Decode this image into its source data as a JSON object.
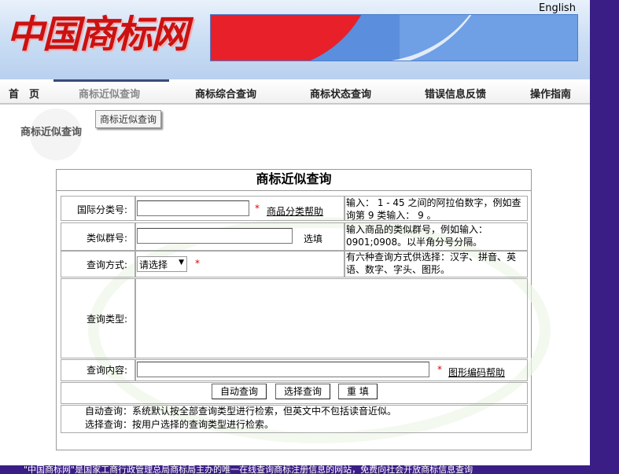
{
  "header": {
    "logo_text": "中国商标网",
    "english_link": "English"
  },
  "nav": {
    "items": [
      "首　页",
      "商标近似查询",
      "商标综合查询",
      "商标状态查询",
      "错误信息反馈",
      "操作指南"
    ]
  },
  "sidebar": {
    "title": "商标近似查询",
    "tooltip": "商标近似查询"
  },
  "form": {
    "title": "商标近似查询",
    "class_label": "国际分类号:",
    "class_value": "",
    "class_help": "商品分类帮助",
    "class_hint": "输入： 1 - 45 之间的阿拉伯数字，例如查询第 9 类输入： 9 。",
    "group_label": "类似群号:",
    "group_value": "",
    "group_optional": "选填",
    "group_hint": "输入商品的类似群号，例如输入：0901;0908。以半角分号分隔。",
    "method_label": "查询方式:",
    "method_selected": "请选择",
    "method_hint": "有六种查询方式供选择：汉字、拼音、英语、数字、字头、图形。",
    "type_label": "查询类型:",
    "content_label": "查询内容:",
    "content_value": "",
    "content_help": "图形编码帮助",
    "required_mark": "*",
    "buttons": {
      "auto": "自动查询",
      "select": "选择查询",
      "reset": "重 填"
    },
    "note_auto": "自动查询：系统默认按全部查询类型进行检索，但英文中不包括读音近似。",
    "note_select": "选择查询：按用户选择的查询类型进行检索。"
  },
  "footer": {
    "text": "\"中国商标网\"是国家工商行政管理总局商标局主办的唯一在线查询商标注册信息的网站，免费向社会开放商标信息查询"
  },
  "colors": {
    "side_strip": "#3a1e86",
    "logo_red": "#cc1111",
    "banner_blue": "#5b8edc",
    "required_red": "#dd0000"
  }
}
